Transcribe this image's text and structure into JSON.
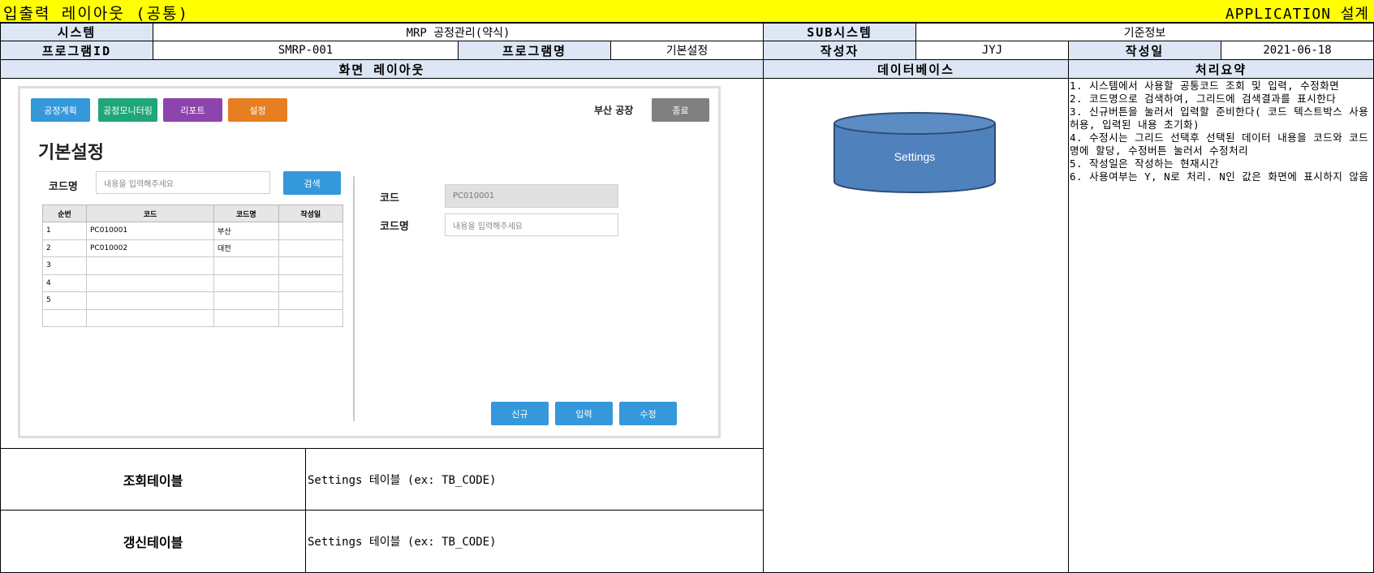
{
  "title": {
    "left": "입출력 레이아웃 (공통)",
    "right": "APPLICATION 설계"
  },
  "info": {
    "system_label": "시스템",
    "system_value": "MRP 공정관리(약식)",
    "subsystem_label": "SUB시스템",
    "subsystem_value": "기준정보",
    "program_id_label": "프로그램ID",
    "program_id_value": "SMRP-001",
    "program_name_label": "프로그램명",
    "program_name_value": "기본설정",
    "author_label": "작성자",
    "author_value": "JYJ",
    "date_label": "작성일",
    "date_value": "2021-06-18"
  },
  "sections": {
    "layout": "화면 레이아웃",
    "database": "데이터베이스",
    "summary": "처리요약"
  },
  "screen": {
    "nav": [
      "공정계획",
      "공정모니터링",
      "리포트",
      "설정"
    ],
    "factory": "부산 공장",
    "exit": "종료",
    "page_title": "기본설정",
    "search": {
      "label": "코드명",
      "placeholder": "내용을 입력해주세요",
      "button": "검색"
    },
    "grid": {
      "columns": [
        "순번",
        "코드",
        "코드명",
        "작성일"
      ],
      "rows": [
        [
          "1",
          "PC010001",
          "부산",
          ""
        ],
        [
          "2",
          "PC010002",
          "대전",
          ""
        ],
        [
          "3",
          "",
          "",
          ""
        ],
        [
          "4",
          "",
          "",
          ""
        ],
        [
          "5",
          "",
          "",
          ""
        ],
        [
          "",
          "",
          "",
          ""
        ]
      ]
    },
    "form": {
      "code_label": "코드",
      "code_value": "PC010001",
      "name_label": "코드명",
      "name_placeholder": "내용을 입력해주세요"
    },
    "actions": [
      "신규",
      "입력",
      "수정"
    ]
  },
  "database": {
    "name": "Settings"
  },
  "summary_lines": [
    "1. 시스템에서 사용할 공통코드 조회 및 입력, 수정화면",
    "2. 코드명으로 검색하여, 그리드에 검색결과를 표시한다",
    "3. 신규버튼을 눌러서 입력할 준비한다( 코드 텍스트박스 사용허용, 입력된 내용 초기화)",
    "4. 수정시는 그리드 선택후 선택된 데이터 내용을 코드와 코드명에 할당, 수정버튼 눌러서 수정처리",
    "5. 작성일은 작성하는 현재시간",
    "6. 사용여부는 Y, N로 처리. N인 값은 화면에 표시하지 않음"
  ],
  "tables": {
    "query_label": "조회테이블",
    "query_value": "Settings 테이블 (ex: TB_CODE)",
    "update_label": "갱신테이블",
    "update_value": "Settings 테이블 (ex: TB_CODE)"
  },
  "colors": {
    "title_bar": "#ffff00",
    "header_cell": "#dce6f4",
    "nav": [
      "#3498db",
      "#1fa67a",
      "#8e44ad",
      "#e67e22"
    ],
    "exit": "#808080",
    "primary": "#3498db",
    "db_fill": "#4f81bd"
  }
}
